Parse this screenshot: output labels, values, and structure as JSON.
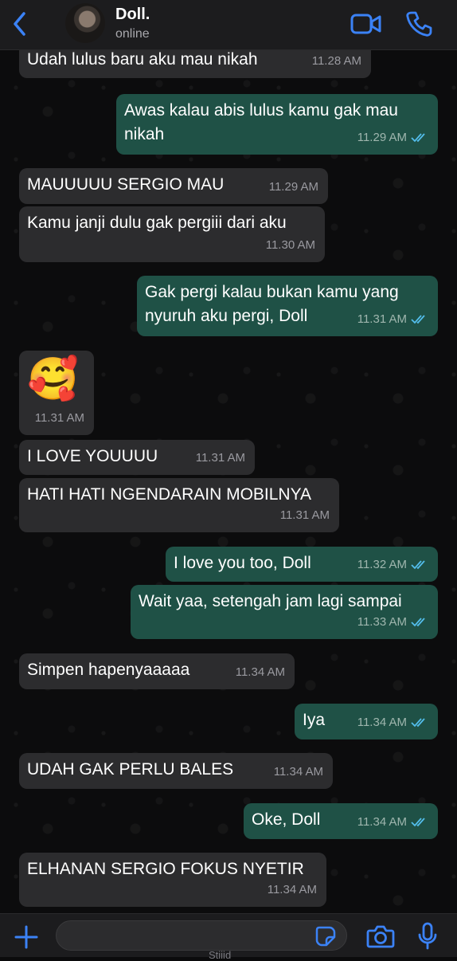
{
  "header": {
    "contact_name": "Doll.",
    "status": "online"
  },
  "colors": {
    "accent": "#3b82f6",
    "incoming_bubble": "#2c2c2e",
    "outgoing_bubble": "#1f5146",
    "read_ticks": "#53bdeb"
  },
  "messages": [
    {
      "direction": "in",
      "text": "Udah lulus baru aku mau nikah",
      "time": "11.28 AM"
    },
    {
      "direction": "out",
      "text": "Awas kalau abis lulus kamu gak mau nikah",
      "time": "11.29 AM",
      "status": "read"
    },
    {
      "direction": "in",
      "text": "MAUUUUU SERGIO MAU",
      "time": "11.29 AM"
    },
    {
      "direction": "in",
      "text": "Kamu janji dulu gak pergiii dari aku",
      "time": "11.30 AM"
    },
    {
      "direction": "out",
      "text": "Gak pergi kalau bukan kamu yang nyuruh aku pergi, Doll",
      "time": "11.31 AM",
      "status": "read"
    },
    {
      "direction": "in",
      "text": "🥰",
      "time": "11.31 AM"
    },
    {
      "direction": "in",
      "text": "I LOVE YOUUUU",
      "time": "11.31 AM"
    },
    {
      "direction": "in",
      "text": "HATI HATI NGENDARAIN MOBILNYA",
      "time": "11.31 AM"
    },
    {
      "direction": "out",
      "text": "I love you too, Doll",
      "time": "11.32 AM",
      "status": "read"
    },
    {
      "direction": "out",
      "text": "Wait yaa, setengah jam lagi sampai",
      "time": "11.33 AM",
      "status": "read"
    },
    {
      "direction": "in",
      "text": "Simpen hapenyaaaaa",
      "time": "11.34 AM"
    },
    {
      "direction": "out",
      "text": "Iya",
      "time": "11.34 AM",
      "status": "read"
    },
    {
      "direction": "in",
      "text": "UDAH GAK PERLU BALES",
      "time": "11.34 AM"
    },
    {
      "direction": "out",
      "text": "Oke, Doll",
      "time": "11.34 AM",
      "status": "read"
    },
    {
      "direction": "in",
      "text": "ELHANAN SERGIO FOKUS NYETIR",
      "time": "11.34 AM"
    }
  ],
  "input": {
    "value": "",
    "footer_text": "Stiiid"
  },
  "icons": {
    "back": "chevron-left-icon",
    "video": "video-camera-icon",
    "call": "phone-icon",
    "plus": "plus-icon",
    "sticker": "sticker-icon",
    "camera": "camera-icon",
    "mic": "microphone-icon",
    "read_receipt": "double-check-icon"
  }
}
